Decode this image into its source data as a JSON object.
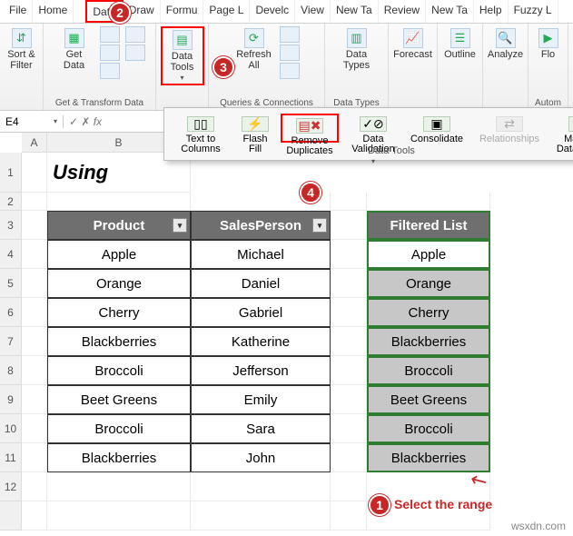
{
  "tabs": {
    "list": [
      "File",
      "Home",
      "",
      "Data",
      "Draw",
      "Formu",
      "Page L",
      "Develc",
      "View",
      "New Ta",
      "Review",
      "New Ta",
      "Help",
      "Fuzzy L"
    ],
    "active_index": 3
  },
  "ribbon": {
    "sort_filter": "Sort &\nFilter",
    "get_data": "Get\nData",
    "group1_label": "Get & Transform Data",
    "data_tools": "Data\nTools",
    "refresh_all": "Refresh\nAll",
    "group2_label": "Queries & Connections",
    "data_types": "Data\nTypes",
    "group3_label": "Data Types",
    "forecast": "Forecast",
    "outline": "Outline",
    "analyze": "Analyze",
    "flo": "Flo",
    "group6_label": "Autom"
  },
  "dtpanel": {
    "text_to_columns": "Text to\nColumns",
    "flash_fill": "Flash\nFill",
    "remove_duplicates": "Remove\nDuplicates",
    "data_validation": "Data\nValidation",
    "consolidate": "Consolidate",
    "relationships": "Relationships",
    "manage_data_model": "Manage\nData Model",
    "label": "Data Tools"
  },
  "fbar": {
    "name": "E4",
    "fx": "fx"
  },
  "sheet": {
    "col_headers": [
      "A",
      "B"
    ],
    "row_headers": [
      "1",
      "2",
      "3",
      "4",
      "5",
      "6",
      "7",
      "8",
      "9",
      "10",
      "11",
      "12",
      ""
    ],
    "title": "Using",
    "headers": {
      "product": "Product",
      "salesperson": "SalesPerson",
      "filtered": "Filtered List"
    },
    "rows": [
      {
        "p": "Apple",
        "s": "Michael",
        "f": "Apple"
      },
      {
        "p": "Orange",
        "s": "Daniel",
        "f": "Orange"
      },
      {
        "p": "Cherry",
        "s": "Gabriel",
        "f": "Cherry"
      },
      {
        "p": "Blackberries",
        "s": "Katherine",
        "f": "Blackberries"
      },
      {
        "p": "Broccoli",
        "s": "Jefferson",
        "f": "Broccoli"
      },
      {
        "p": "Beet Greens",
        "s": "Emily",
        "f": "Beet Greens"
      },
      {
        "p": "Broccoli",
        "s": "Sara",
        "f": "Broccoli"
      },
      {
        "p": "Blackberries",
        "s": "John",
        "f": "Blackberries"
      }
    ]
  },
  "callouts": {
    "c1": "1",
    "c2": "2",
    "c3": "3",
    "c4": "4",
    "select_range": "Select the range"
  },
  "watermark": "wsxdn.com"
}
